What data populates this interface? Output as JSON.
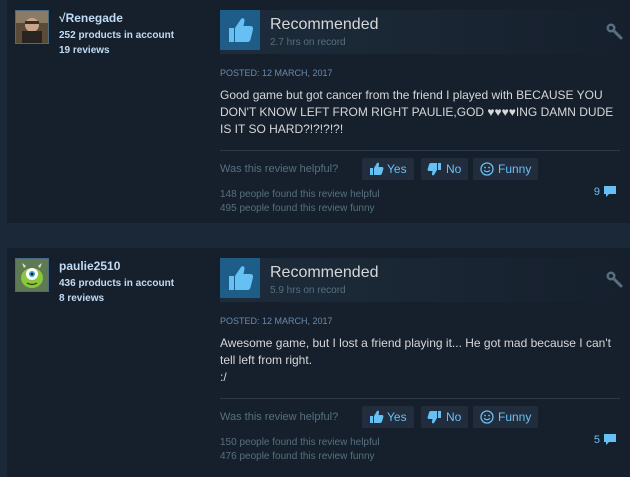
{
  "reviews": [
    {
      "author": {
        "name": "√Renegade",
        "products": "252 products in account",
        "reviews": "19 reviews"
      },
      "verdict": "Recommended",
      "hours": "2.7 hrs on record",
      "posted": "POSTED: 12 MARCH, 2017",
      "text": "Good game but got cancer from the friend I played with BECAUSE YOU DON'T KNOW LEFT FROM RIGHT PAULIE,GOD ♥♥♥♥ING DAMN DUDE IS IT SO HARD?!?!?!?!",
      "helpful_question": "Was this review helpful?",
      "yes_label": "Yes",
      "no_label": "No",
      "funny_label": "Funny",
      "found_helpful": "148 people found this review helpful",
      "found_funny": "495 people found this review funny",
      "comment_count": "9"
    },
    {
      "author": {
        "name": "paulie2510",
        "products": "436 products in account",
        "reviews": "8 reviews"
      },
      "verdict": "Recommended",
      "hours": "5.9 hrs on record",
      "posted": "POSTED: 12 MARCH, 2017",
      "text": "Awesome game, but I lost a friend playing it... He got mad because I can't tell left from right.\n:/",
      "helpful_question": "Was this review helpful?",
      "yes_label": "Yes",
      "no_label": "No",
      "funny_label": "Funny",
      "found_helpful": "150 people found this review helpful",
      "found_funny": "476 people found this review funny",
      "comment_count": "5"
    }
  ],
  "icons": {
    "thumb": "thumbs-up-icon",
    "settings": "wrench-icon",
    "yes": "thumbs-up-icon",
    "no": "thumbs-down-icon",
    "funny": "smiley-icon",
    "comment": "comment-icon"
  },
  "colors": {
    "background": "#1b2838",
    "card": "#16202d",
    "accent": "#66c0f4",
    "thumb_bg": "#1e5d88"
  }
}
